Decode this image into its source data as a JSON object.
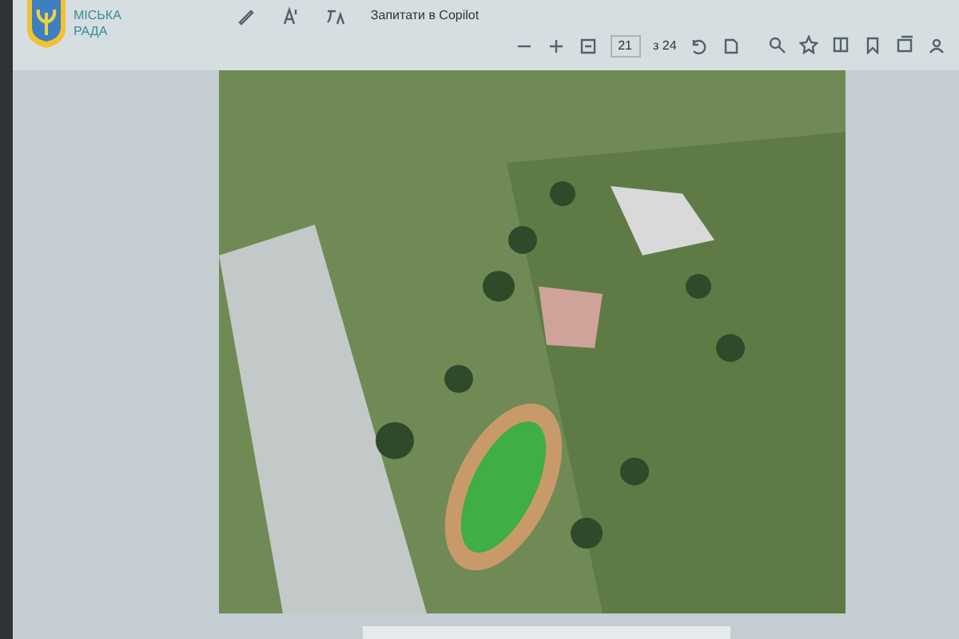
{
  "logo": {
    "lines": [
      "МІСЬКА",
      "РАДА"
    ]
  },
  "toolbar": {
    "copilot_label": "Запитати в Copilot",
    "page_number": "21",
    "page_total": "з 24"
  }
}
